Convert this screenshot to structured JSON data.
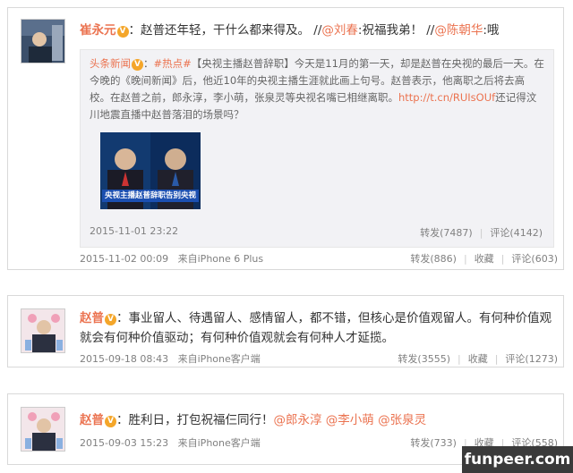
{
  "posts": [
    {
      "author": "崔永元",
      "verified_badge": "V",
      "text_pre": "：赵普还年轻，干什么都来得及。 //",
      "mention1": "@刘春",
      "text_mid": ":祝福我弟！ //",
      "mention2": "@陈朝华",
      "text_post": ":哦",
      "repost": {
        "author": "头条新闻",
        "verified_badge": "V",
        "hashtag": "#热点#",
        "text_1": "【央视主播赵普辞职】今天是11月的第一天，却是赵普在央视的最后一天。在今晚的《晚间新闻》后，他近10年的央视主播生涯就此画上句号。赵普表示，他离职之后将去高校。在赵普之前，郎永淳，李小萌，张泉灵等央视名嘴已相继离职。",
        "url": "http://t.cn/RUIsOUf",
        "text_2": "还记得汶川地震直播中赵普落泪的场景吗？",
        "image_caption": "央视主播赵普辞职告别央视",
        "time": "2015-11-01 23:22",
        "repost_label": "转发(7487)",
        "comment_label": "评论(4142)"
      },
      "time": "2015-11-02 00:09",
      "source": "来自iPhone 6 Plus",
      "repost_label": "转发(886)",
      "fav_label": "收藏",
      "comment_label": "评论(603)"
    },
    {
      "author": "赵普",
      "verified_badge": "V",
      "text": "：事业留人、待遇留人、感情留人，都不错，但核心是价值观留人。有何种价值观就会有何种价值驱动；有何种价值观就会有何种人才延揽。",
      "time": "2015-09-18 08:43",
      "source": "来自iPhone客户端",
      "repost_label": "转发(3555)",
      "fav_label": "收藏",
      "comment_label": "评论(1273)"
    },
    {
      "author": "赵普",
      "verified_badge": "V",
      "text": "：胜利日，打包祝福仨同行！",
      "mention1": "@郎永淳",
      "mention2": "@李小萌",
      "mention3": "@张泉灵",
      "time": "2015-09-03 15:23",
      "source": "来自iPhone客户端",
      "repost_label": "转发(733)",
      "fav_label": "收藏",
      "comment_label": "评论(558)"
    }
  ],
  "watermark": "funpeer.com",
  "colors": {
    "accent": "#eb7350",
    "meta": "#808080",
    "repost_bg": "#f2f2f5",
    "badge": "#f4a62a"
  }
}
